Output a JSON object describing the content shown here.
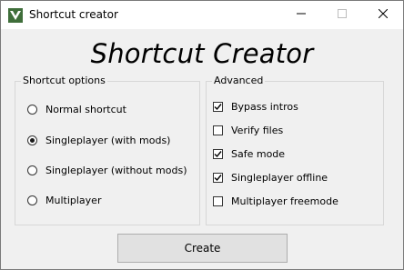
{
  "window": {
    "title": "Shortcut creator",
    "controls": [
      "minimize-icon",
      "maximize-icon",
      "close-icon"
    ]
  },
  "heading": "Shortcut Creator",
  "shortcut_options": {
    "legend": "Shortcut options",
    "options": [
      {
        "label": "Normal shortcut",
        "selected": false
      },
      {
        "label": "Singleplayer (with mods)",
        "selected": true
      },
      {
        "label": "Singleplayer (without mods)",
        "selected": false
      },
      {
        "label": "Multiplayer",
        "selected": false
      }
    ]
  },
  "advanced": {
    "legend": "Advanced",
    "options": [
      {
        "label": "Bypass intros",
        "checked": true
      },
      {
        "label": "Verify files",
        "checked": false
      },
      {
        "label": "Safe mode",
        "checked": true
      },
      {
        "label": "Singleplayer offline",
        "checked": true
      },
      {
        "label": "Multiplayer freemode",
        "checked": false
      }
    ]
  },
  "create_button": "Create",
  "colors": {
    "window_bg": "#f0f0f0",
    "titlebar_bg": "#ffffff",
    "button_bg": "#e1e1e1",
    "group_border": "#d7d7d7",
    "logo_green": "#3f6e3a"
  }
}
